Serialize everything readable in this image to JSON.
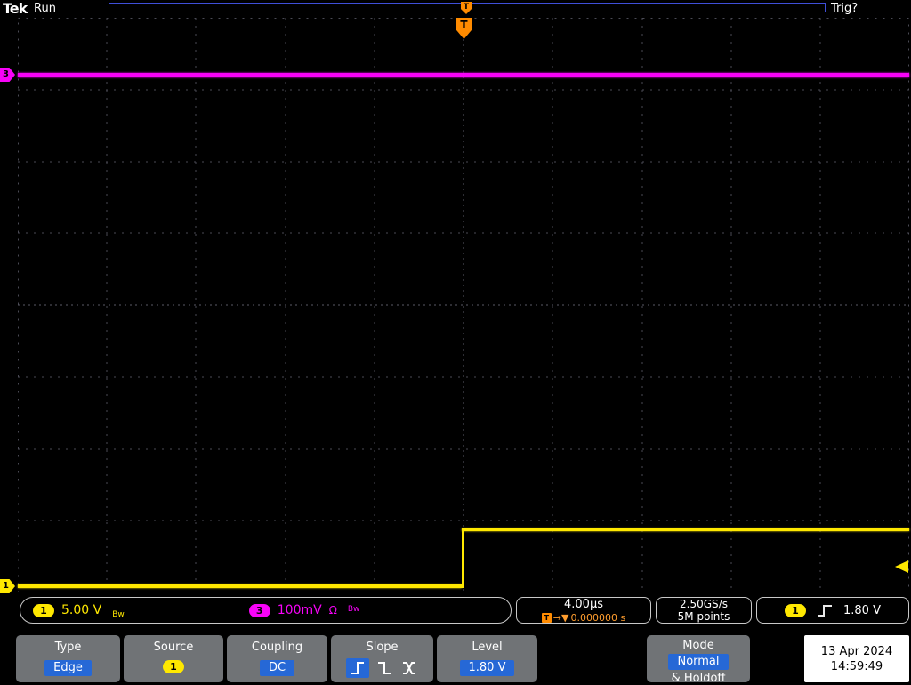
{
  "header": {
    "logo": "Tek",
    "acq_status": "Run",
    "trig_status": "Trig?"
  },
  "trigger": {
    "t": "T",
    "arrow": "→▼"
  },
  "markers": {
    "ch1": "1",
    "ch3": "3"
  },
  "readouts": {
    "ch1_badge": "1",
    "ch1_scale": "5.00 V",
    "ch1_bw": "Bw",
    "ch3_badge": "3",
    "ch3_scale": "100mV",
    "ch3_ohm": "Ω",
    "ch3_bw": "Bw",
    "timebase": "4.00µs",
    "trig_pos": "0.000000 s",
    "sample_rate": "2.50GS/s",
    "record_length": "5M points",
    "trig_source": "1",
    "trig_level": "1.80 V"
  },
  "menu": {
    "type": {
      "title": "Type",
      "value": "Edge"
    },
    "source": {
      "title": "Source",
      "value": "1"
    },
    "coupling": {
      "title": "Coupling",
      "value": "DC"
    },
    "slope": {
      "title": "Slope"
    },
    "level": {
      "title": "Level",
      "value": "1.80 V"
    },
    "mode": {
      "title": "Mode",
      "value": "Normal",
      "suffix": "& Holdoff"
    },
    "datetime": {
      "date": "13 Apr 2024",
      "time": "14:59:49"
    }
  },
  "colors": {
    "ch1": "#ffe800",
    "ch3": "#f803f8",
    "trigger_orange": "#ff8b00",
    "highlight_blue": "#2668d6",
    "button_gray": "#707376"
  },
  "chart_data": {
    "type": "line",
    "title": "Oscilloscope waveform display",
    "x_axis": {
      "units": "s",
      "time_per_div": "4.00µs",
      "divisions": 10,
      "trigger_position_s": 0
    },
    "y_axis": {
      "divisions": 8
    },
    "series": [
      {
        "name": "CH1",
        "volts_per_div": "5.00 V",
        "color": "#ffe800",
        "points_div": [
          [
            -5,
            0
          ],
          [
            0,
            0
          ],
          [
            0,
            0.8
          ],
          [
            5,
            0.8
          ]
        ],
        "description": "Low before trigger, steps up about 0.8 div (~4 V) at t=0"
      },
      {
        "name": "CH3",
        "volts_per_div": "100mV",
        "color": "#f803f8",
        "points_div": [
          [
            -5,
            3.2
          ],
          [
            5,
            3.2
          ]
        ],
        "description": "Constant level near top of screen"
      }
    ],
    "grid": true,
    "legend": false
  }
}
